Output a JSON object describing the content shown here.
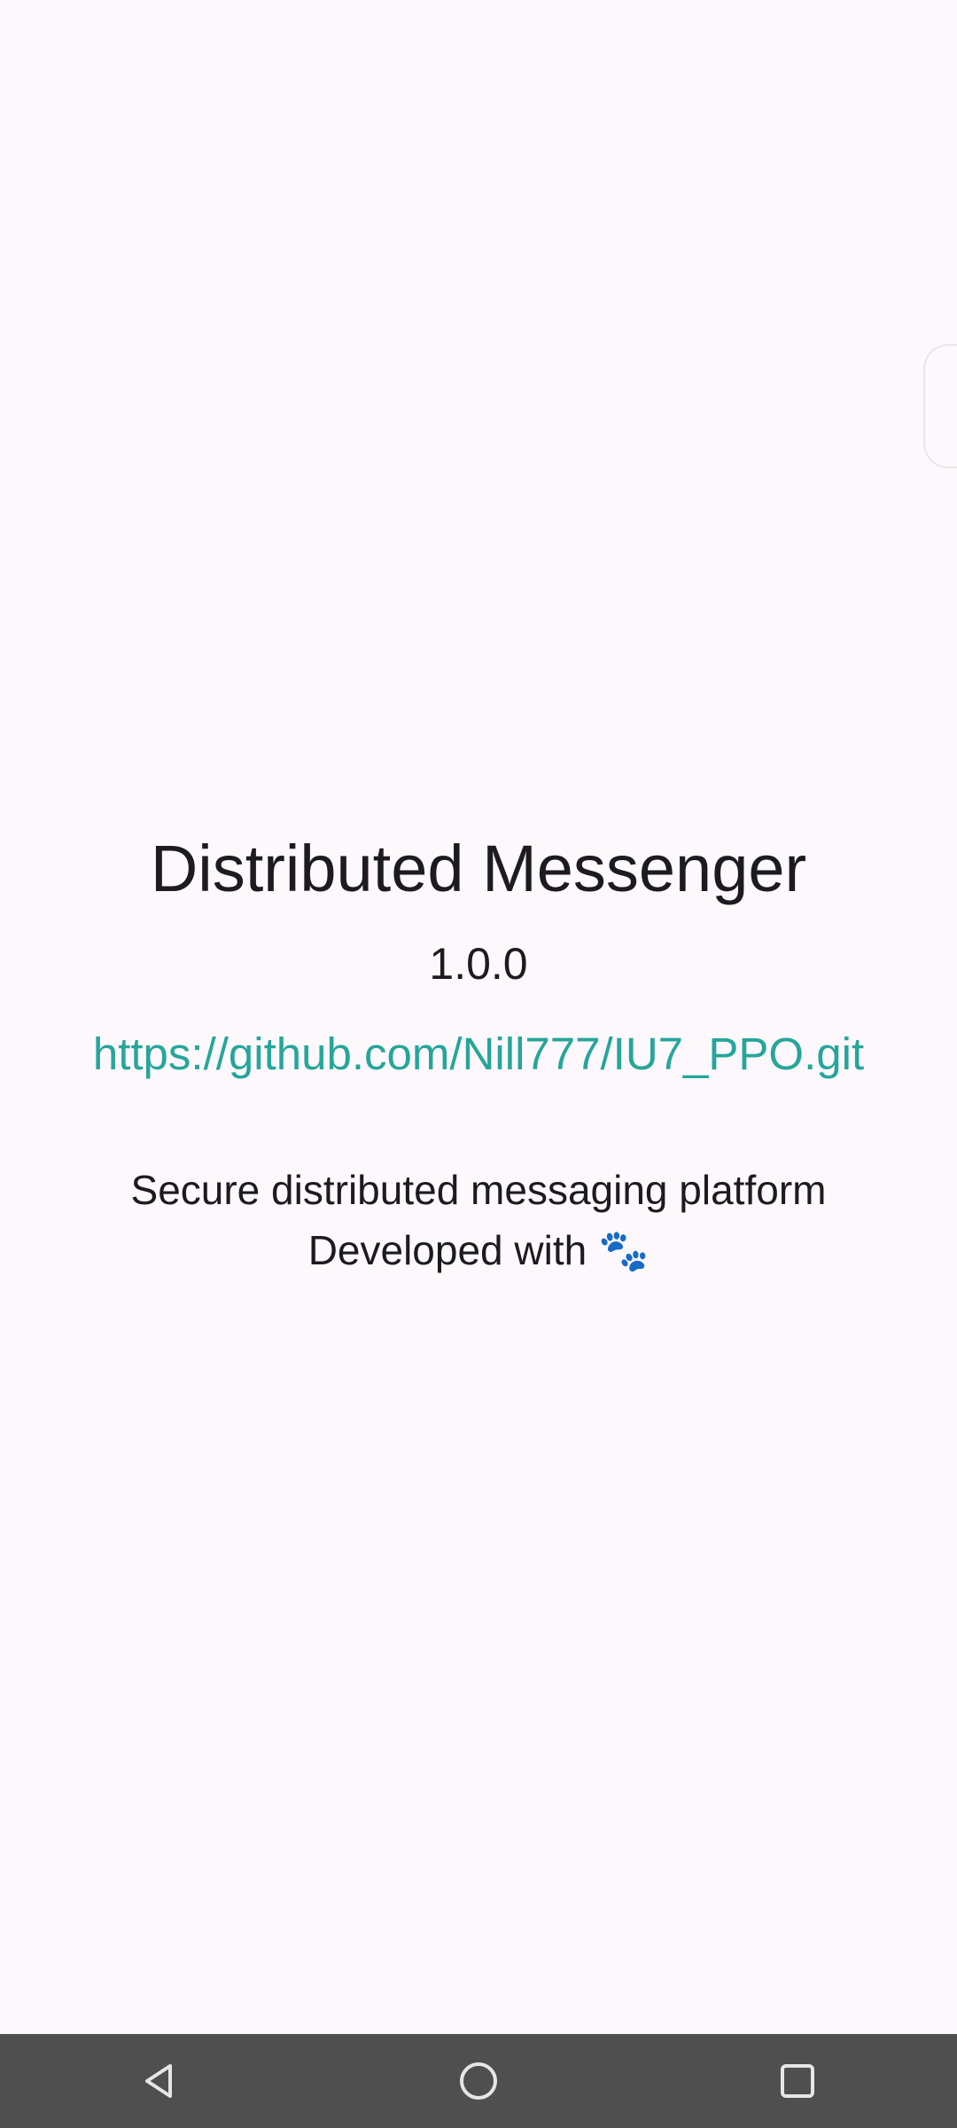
{
  "app": {
    "title": "Distributed Messenger",
    "version": "1.0.0",
    "repo_url": "https://github.com/Nill777/IU7_PPO.git",
    "description_line1": "Secure distributed messaging platform",
    "description_line2_prefix": "Developed with ",
    "description_emoji": "🐾"
  },
  "colors": {
    "background": "#FDF8FB",
    "link": "#26A69A",
    "nav_bar": "#4F4F4F"
  },
  "icons": {
    "nav_back": "back-triangle-icon",
    "nav_home": "home-circle-icon",
    "nav_recents": "recents-square-icon"
  }
}
